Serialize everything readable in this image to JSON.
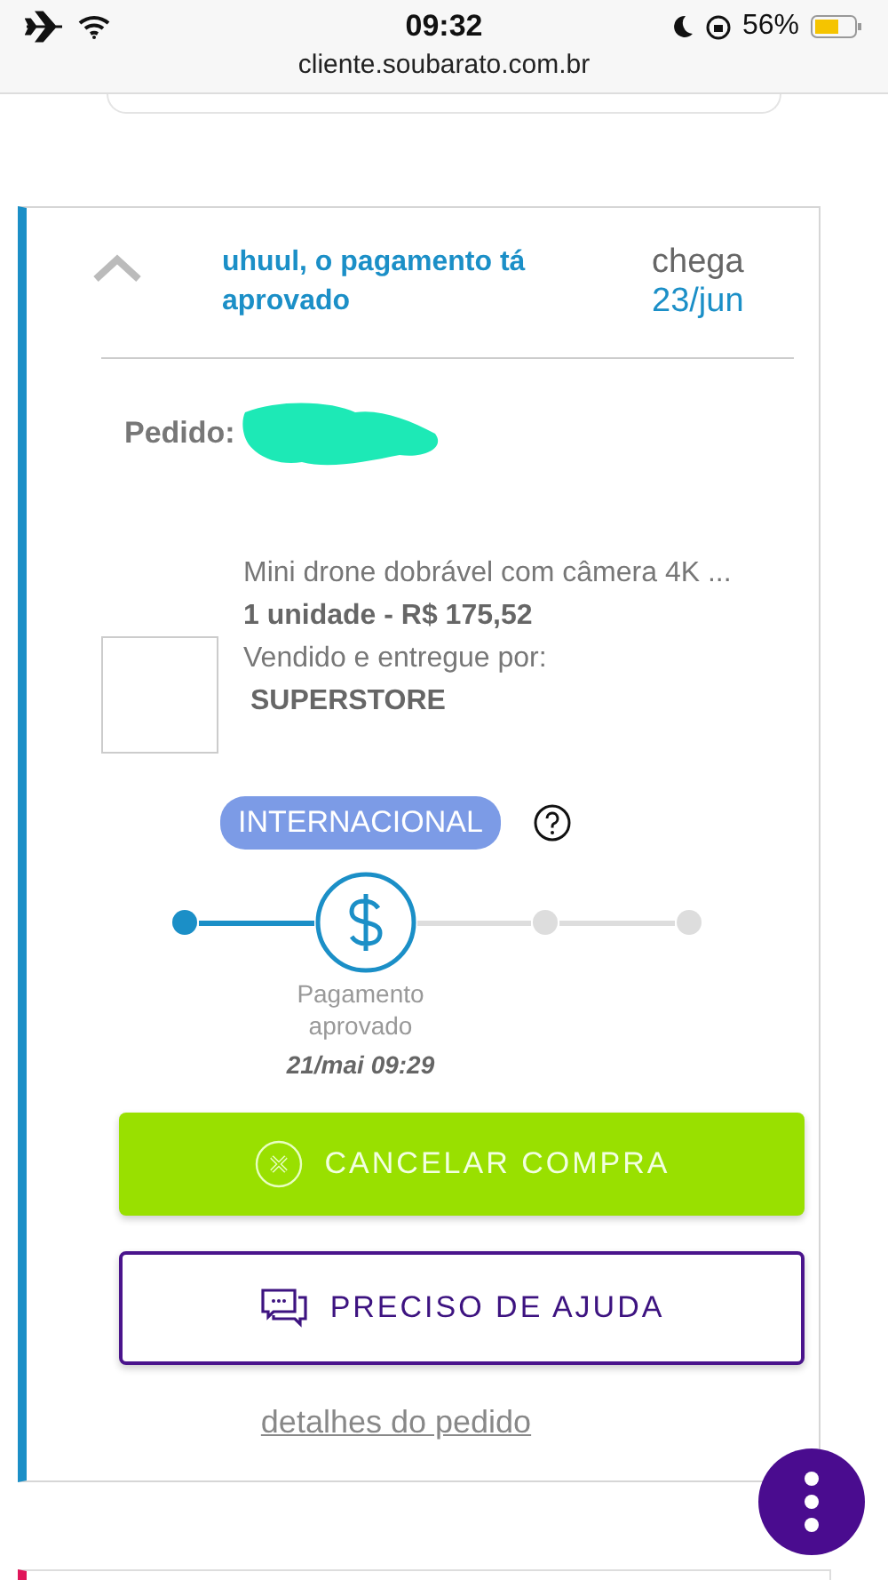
{
  "status_bar": {
    "time": "09:32",
    "battery": "56%"
  },
  "browser": {
    "url": "cliente.soubarato.com.br"
  },
  "order": {
    "expanded": true,
    "status_title": "uhuul, o pagamento tá aprovado",
    "arrival_label": "chega",
    "arrival_date": "23/jun",
    "order_label": "Pedido:",
    "product": {
      "name": "Mini drone dobrável com câmera 4K ...",
      "quantity_price": "1 unidade - R$ 175,52",
      "seller_label": "Vendido e entregue por:",
      "seller": "SUPERSTORE"
    },
    "badge": "INTERNACIONAL",
    "steps": [
      {
        "kind": "done"
      },
      {
        "kind": "current",
        "label": "Pagamento aprovado",
        "date": "21/mai 09:29"
      },
      {
        "kind": "pending"
      },
      {
        "kind": "pending"
      }
    ],
    "buttons": [
      {
        "kind": "cancel",
        "label": "CANCELAR COMPRA"
      },
      {
        "kind": "help",
        "label": "PRECISO DE AJUDA"
      }
    ],
    "details_link": "detalhes do pedido"
  }
}
